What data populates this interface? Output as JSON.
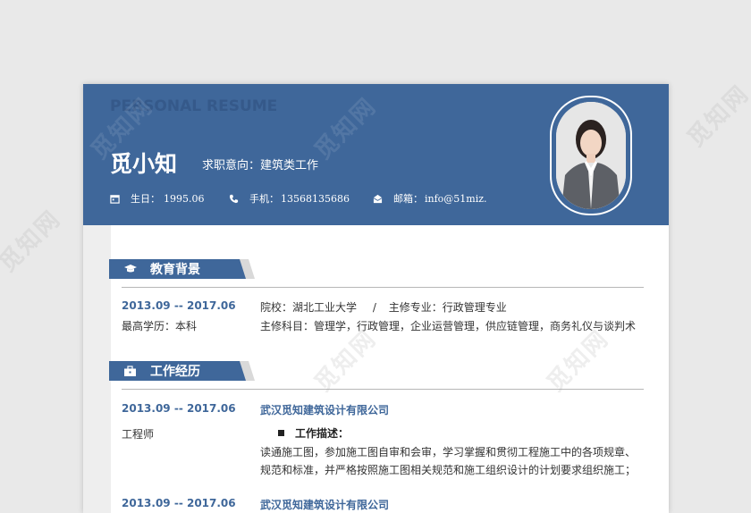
{
  "header": {
    "bg_text": "PERSONAL RESUME",
    "name": "觅小知",
    "job_label": "求职意向：",
    "job_value": "建筑类工作",
    "birth_label": "生日：",
    "birth_value": "1995.06",
    "phone_label": "手机：",
    "phone_value": "13568135686",
    "email_label": "邮箱：",
    "email_value": "info@51miz."
  },
  "education": {
    "title": "教育背景",
    "date": "2013.09 -- 2017.06",
    "degree": "最高学历：本科",
    "school": "院校：湖北工业大学",
    "separator": "/",
    "major": "主修专业：行政管理专业",
    "courses": "主修科目：管理学，行政管理，企业运营管理，供应链管理，商务礼仪与谈判术"
  },
  "work": {
    "title": "工作经历",
    "jobs": [
      {
        "date": "2013.09 -- 2017.06",
        "company": "武汉觅知建筑设计有限公司",
        "position": "工程师",
        "desc_title": "工作描述：",
        "desc_line1": "读通施工图，参加施工图自审和会审，学习掌握和贯彻工程施工中的各项规章、",
        "desc_line2": "规范和标准，并严格按照施工图相关规范和施工组织设计的计划要求组织施工；"
      },
      {
        "date": "2013.09 -- 2017.06",
        "company": "武汉觅知建筑设计有限公司"
      }
    ]
  },
  "watermark": "觅知网",
  "colors": {
    "primary": "#3f679a",
    "tab_gray": "#d9d9d9"
  },
  "icons": [
    "calendar-icon",
    "phone-icon",
    "mail-icon",
    "graduation-cap-icon",
    "briefcase-icon"
  ]
}
